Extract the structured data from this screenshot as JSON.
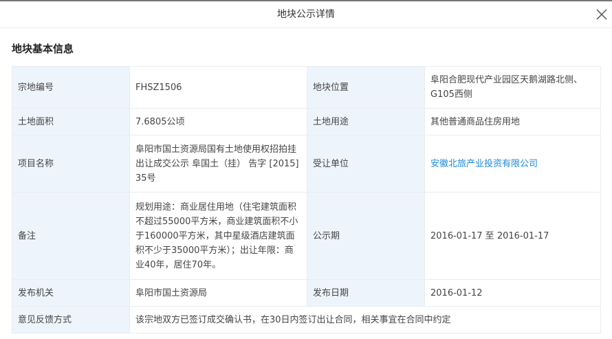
{
  "dialog": {
    "title": "地块公示详情",
    "close_icon": "close-icon"
  },
  "section_title": "地块基本信息",
  "rows": [
    {
      "l1": "宗地编号",
      "v1": "FHSZ1506",
      "l2": "地块位置",
      "v2": "阜阳合肥现代产业园区天鹅湖路北侧、G105西侧"
    },
    {
      "l1": "土地面积",
      "v1": "7.6805公顷",
      "l2": "土地用途",
      "v2": "其他普通商品住房用地"
    },
    {
      "l1": "项目名称",
      "v1": "阜阳市国土资源局国有土地使用权招拍挂出让成交公示 阜国土（挂） 告字 [2015] 35号",
      "l2": "受让单位",
      "v2": "安徽北旅产业投资有限公司"
    },
    {
      "l1": "备注",
      "v1": "规划用途：商业居住用地（住宅建筑面积不超过55000平方米，商业建筑面积不小于160000平方米，其中星级酒店建筑面积不少于35000平方米）；出让年限：商业40年，居住70年。",
      "l2": "公示期",
      "v2": "2016-01-17 至 2016-01-17"
    },
    {
      "l1": "发布机关",
      "v1": "阜阳市国土资源局",
      "l2": "发布日期",
      "v2": "2016-01-12"
    }
  ],
  "feedback": {
    "label": "意见反馈方式",
    "value": "该宗地双方已签订成交确认书，在30日内签订出让合同，相关事宜在合同中约定"
  },
  "colors": {
    "link": "#1a8ad8",
    "label_bg": "#eef4fb"
  }
}
